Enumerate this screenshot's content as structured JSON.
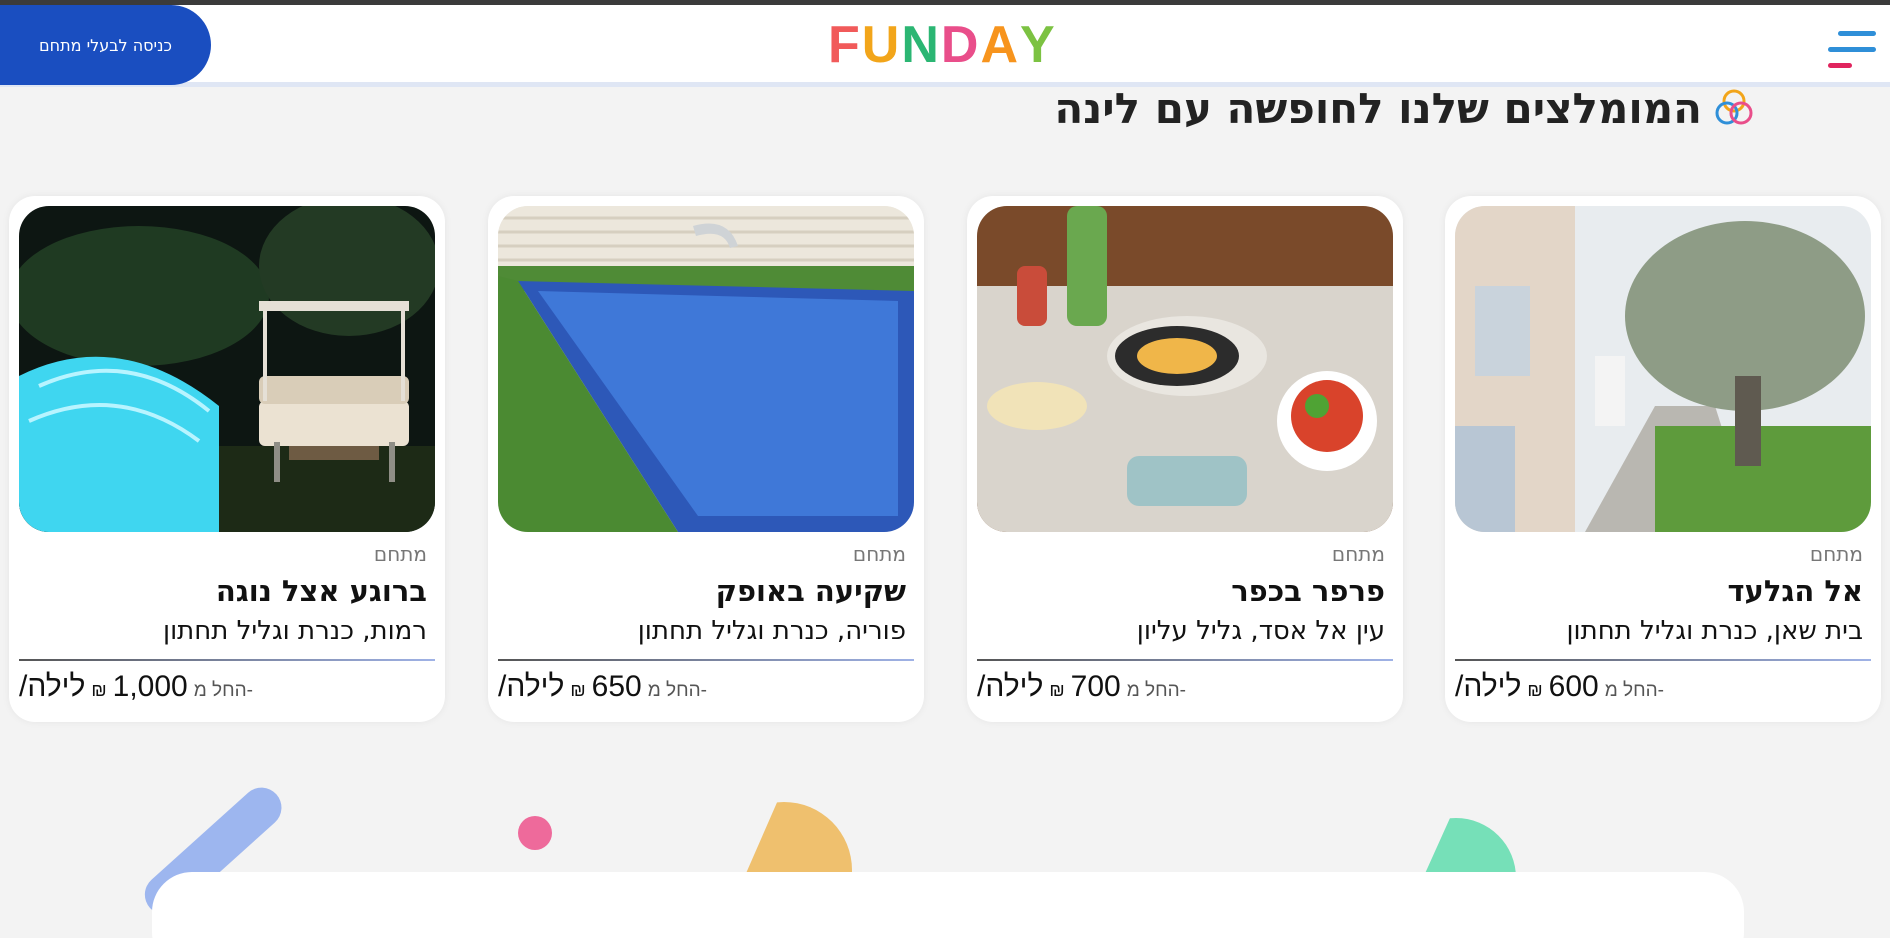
{
  "header": {
    "owner_button_label": "כניסה לבעלי מתחם",
    "logo_letters": [
      {
        "ch": "F",
        "color": "#f15a5a"
      },
      {
        "ch": "U",
        "color": "#f2a51a"
      },
      {
        "ch": "N",
        "color": "#2bb673"
      },
      {
        "ch": "D",
        "color": "#e94e8a"
      },
      {
        "ch": "A",
        "color": "#f7941d"
      },
      {
        "ch": "Y",
        "color": "#7cc242"
      }
    ],
    "menu_icon": "hamburger-icon"
  },
  "section": {
    "title": "המומלצים שלנו לחופשה עם לינה",
    "icon": "rings-icon"
  },
  "cards": [
    {
      "category": "מתחם",
      "name": "אל הגלעד",
      "location": "בית שאן, כנרת וגליל תחתון",
      "from_label": "החל מ-",
      "price": "600",
      "currency": "₪",
      "per_night": "/לילה",
      "image": "house-with-olive-tree"
    },
    {
      "category": "מתחם",
      "name": "פרפר בכפר",
      "location": "עין אל אסד, גליל עליון",
      "from_label": "החל מ-",
      "price": "700",
      "currency": "₪",
      "per_night": "/לילה",
      "image": "breakfast-table"
    },
    {
      "category": "מתחם",
      "name": "שקיעה באופק",
      "location": "פוריה, כנרת וגליל תחתון",
      "from_label": "החל מ-",
      "price": "650",
      "currency": "₪",
      "per_night": "/לילה",
      "image": "pool-with-waterfall"
    },
    {
      "category": "מתחם",
      "name": "ברוגע אצל נוגה",
      "location": "רמות, כנרת וגליל תחתון",
      "from_label": "החל מ-",
      "price": "1,000",
      "currency": "₪",
      "per_night": "/לילה",
      "image": "covered-pool-at-night"
    }
  ],
  "decorations": {
    "colors": {
      "pink": "#ee6a9b",
      "yellow": "#efc06e",
      "green": "#76e0b8",
      "blue": "#9db6ef"
    }
  },
  "colors": {
    "brand_blue": "#1a4ec0",
    "background": "#f3f3f3"
  }
}
